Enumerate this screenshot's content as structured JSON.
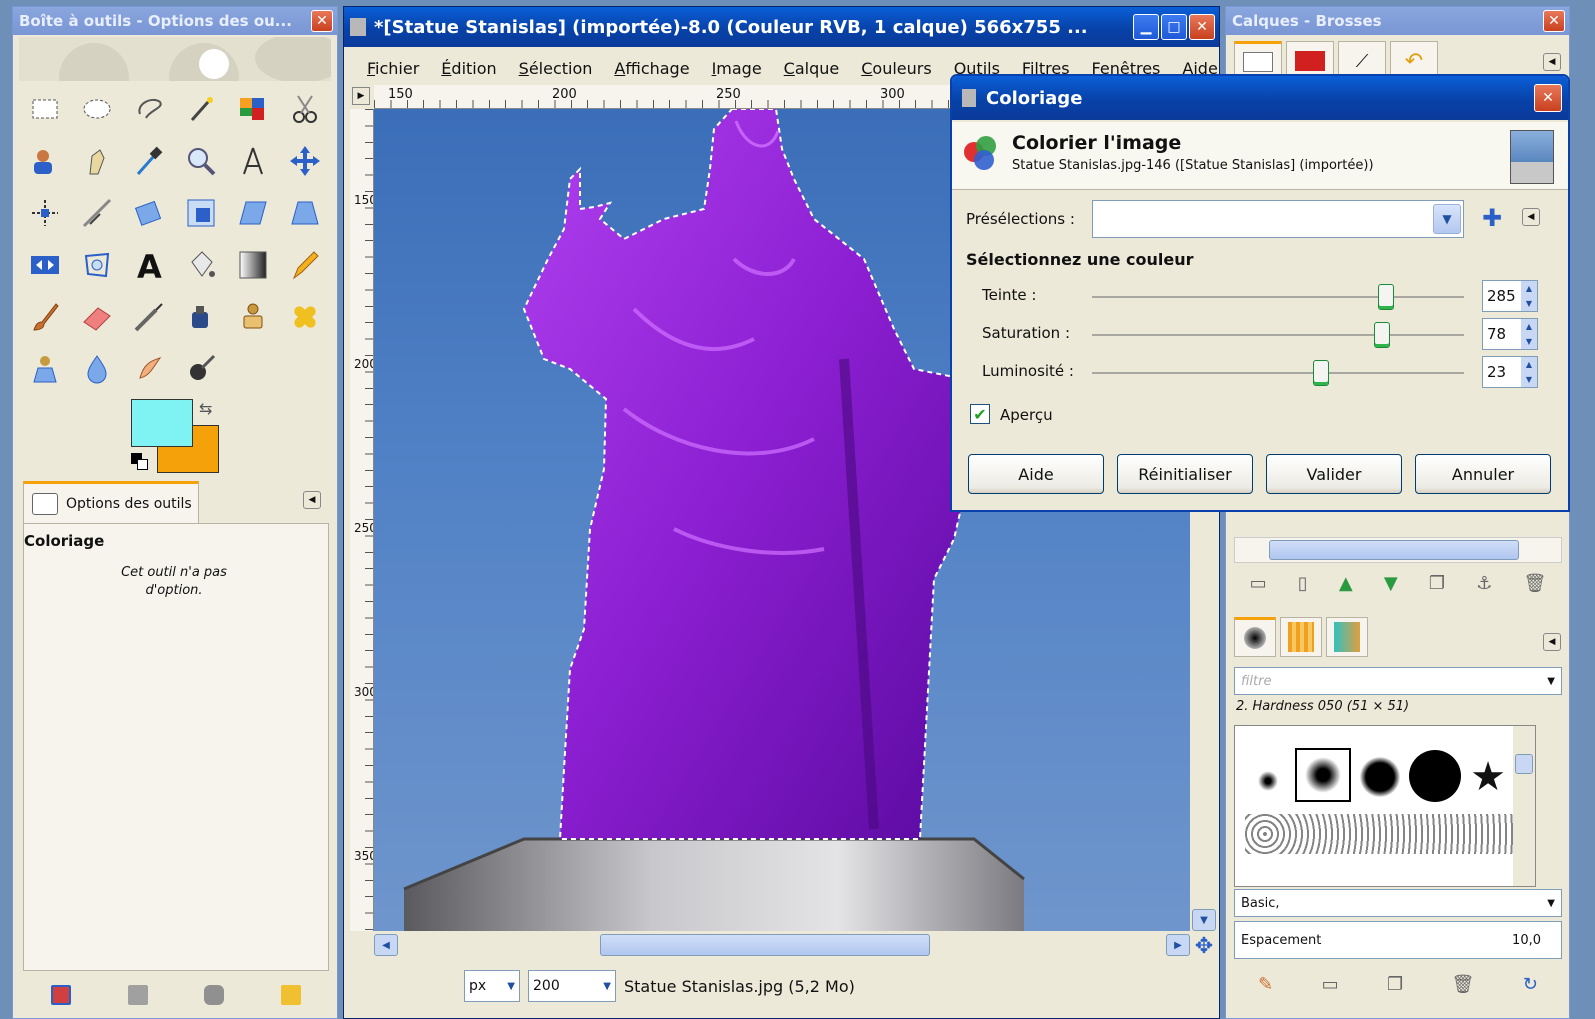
{
  "toolbox": {
    "title": "Boîte à outils - Options des ou...",
    "options_tab_label": "Options des outils",
    "options_title": "Coloriage",
    "options_note": "Cet outil n'a pas d'option.",
    "fg_color": "#7ff2f4",
    "bg_color": "#f5a20a",
    "tools": [
      "rect-select-icon",
      "ellipse-select-icon",
      "free-select-icon",
      "fuzzy-select-icon",
      "color-select-icon",
      "scissors-icon",
      "foreground-select-icon",
      "paths-icon",
      "color-picker-icon",
      "zoom-icon",
      "measure-icon",
      "move-icon",
      "align-icon",
      "crop-icon",
      "rotate-icon",
      "scale-icon",
      "shear-icon",
      "perspective-icon",
      "flip-icon",
      "cage-icon",
      "text-icon",
      "bucket-fill-icon",
      "blend-icon",
      "pencil-icon",
      "paintbrush-icon",
      "eraser-icon",
      "airbrush-icon",
      "ink-icon",
      "clone-icon",
      "heal-icon",
      "perspective-clone-icon",
      "blur-icon",
      "smudge-icon",
      "dodge-burn-icon"
    ]
  },
  "image_window": {
    "title": "*[Statue Stanislas] (importée)-8.0 (Couleur RVB, 1 calque) 566x755 ...",
    "menu": [
      "Fichier",
      "Édition",
      "Sélection",
      "Affichage",
      "Image",
      "Calque",
      "Couleurs",
      "Outils",
      "Filtres",
      "Fenêtres",
      "Aide"
    ],
    "ruler_h": [
      "150",
      "200",
      "250",
      "300"
    ],
    "ruler_v": [
      "150",
      "200",
      "250",
      "300",
      "350"
    ],
    "status": {
      "unit": "px",
      "zoom": "200",
      "zoom_suffix": "",
      "file_info": "Statue Stanislas.jpg (5,2 Mo)"
    }
  },
  "dock": {
    "title": "Calques - Brosses",
    "brush_filter_placeholder": "filtre",
    "brush_name": "2. Hardness 050 (51 × 51)",
    "tag": "Basic,",
    "spacing_label": "Espacement",
    "spacing_value": "10,0"
  },
  "dialog": {
    "title": "Coloriage",
    "heading": "Colorier l'image",
    "subheading": "Statue Stanislas.jpg-146 ([Statue Stanislas] (importée))",
    "presets_label": "Présélections :",
    "section_label": "Sélectionnez une couleur",
    "sliders": [
      {
        "label": "Teinte :",
        "value": "285",
        "fraction": 0.79
      },
      {
        "label": "Saturation :",
        "value": "78",
        "fraction": 0.78
      },
      {
        "label": "Luminosité :",
        "value": "23",
        "fraction": 0.615
      }
    ],
    "preview_label": "Aperçu",
    "preview_checked": true,
    "buttons": {
      "help": "Aide",
      "reset": "Réinitialiser",
      "ok": "Valider",
      "cancel": "Annuler"
    }
  }
}
